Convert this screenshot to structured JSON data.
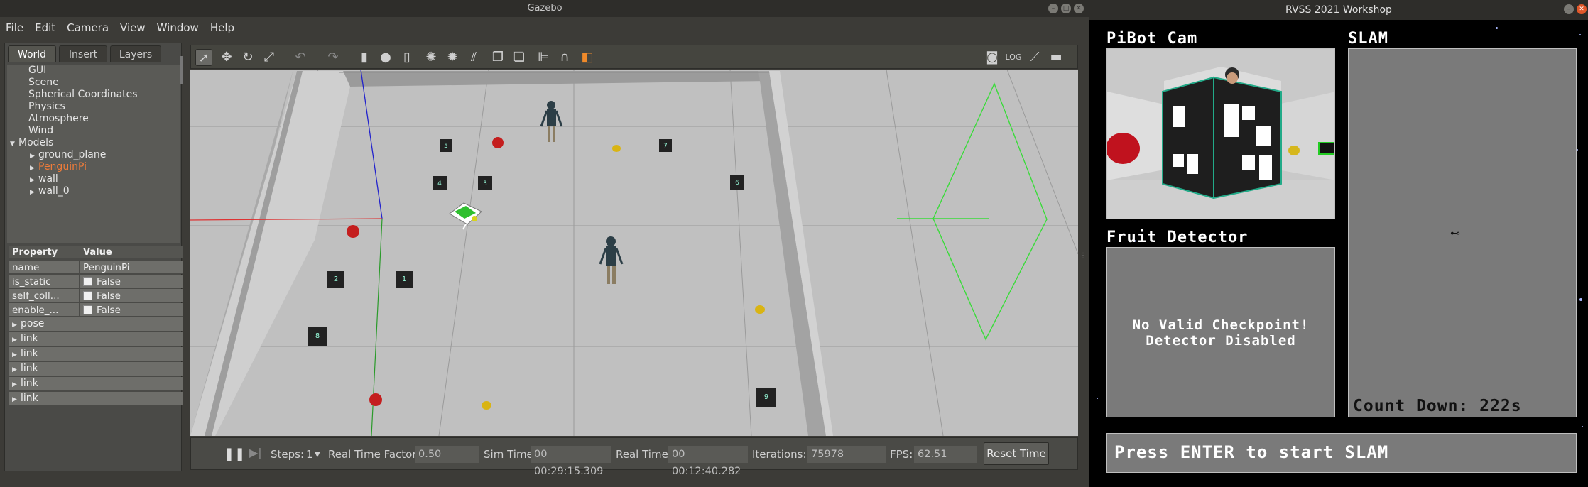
{
  "gazebo": {
    "title": "Gazebo",
    "menu": [
      "File",
      "Edit",
      "Camera",
      "View",
      "Window",
      "Help"
    ],
    "tabs": [
      "World",
      "Insert",
      "Layers"
    ],
    "tree": [
      {
        "label": "GUI",
        "indent": 1,
        "arrow": ""
      },
      {
        "label": "Scene",
        "indent": 1,
        "arrow": ""
      },
      {
        "label": "Spherical Coordinates",
        "indent": 1,
        "arrow": ""
      },
      {
        "label": "Physics",
        "indent": 1,
        "arrow": ""
      },
      {
        "label": "Atmosphere",
        "indent": 1,
        "arrow": ""
      },
      {
        "label": "Wind",
        "indent": 1,
        "arrow": ""
      },
      {
        "label": "Models",
        "indent": 0,
        "arrow": "▼"
      },
      {
        "label": "ground_plane",
        "indent": 2,
        "arrow": "▶"
      },
      {
        "label": "PenguinPi",
        "indent": 2,
        "arrow": "▶",
        "selected": true
      },
      {
        "label": "wall",
        "indent": 2,
        "arrow": "▶"
      },
      {
        "label": "wall_0",
        "indent": 2,
        "arrow": "▶"
      }
    ],
    "props_header": {
      "property": "Property",
      "value": "Value"
    },
    "props": [
      {
        "name": "name",
        "value": "PenguinPi",
        "checkbox": false
      },
      {
        "name": "is_static",
        "value": "False",
        "checkbox": true
      },
      {
        "name": "self_coll...",
        "value": "False",
        "checkbox": true
      },
      {
        "name": "enable_...",
        "value": "False",
        "checkbox": true
      }
    ],
    "expandables": [
      "pose",
      "link",
      "link",
      "link",
      "link",
      "link"
    ],
    "bottom": {
      "steps_label": "Steps:",
      "steps_value": "1",
      "rtf_label": "Real Time Factor:",
      "rtf_value": "0.50",
      "sim_label": "Sim Time:",
      "sim_value": "00 00:29:15.309",
      "real_label": "Real Time:",
      "real_value": "00 00:12:40.282",
      "iter_label": "Iterations:",
      "iter_value": "75978",
      "fps_label": "FPS:",
      "fps_value": "62.51",
      "reset_label": "Reset Time"
    },
    "scene_markers": [
      "5",
      "7",
      "4",
      "3",
      "6",
      "2",
      "1",
      "8",
      "9"
    ]
  },
  "rvss": {
    "title": "RVSS 2021 Workshop",
    "cam_title": "PiBot Cam",
    "slam_title": "SLAM",
    "fruit_title": "Fruit Detector",
    "fruit_msg_line1": "No Valid Checkpoint!",
    "fruit_msg_line2": "Detector Disabled",
    "countdown": "Count Down: 222s",
    "enter_msg": "Press ENTER to start SLAM"
  }
}
